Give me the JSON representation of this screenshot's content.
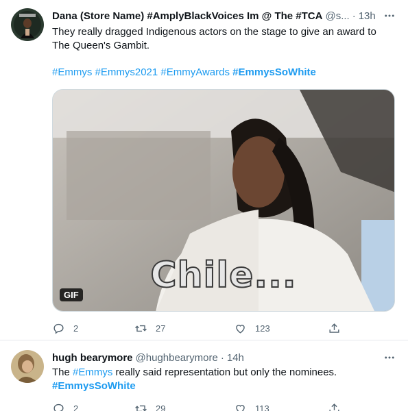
{
  "tweets": [
    {
      "display_name": "Dana (Store Name) #AmplyBlackVoices Im @ The #TCA",
      "handle": "@s...",
      "separator": "·",
      "time": "13h",
      "text_line": "They really dragged Indigenous actors on the stage to give an award to The Queen's Gambit.",
      "hashtags": [
        "#Emmys",
        "#Emmys2021",
        "#EmmyAwards",
        "#EmmysSoWhite"
      ],
      "media": {
        "caption": "Chile...",
        "badge": "GIF"
      },
      "replies": "2",
      "retweets": "27",
      "likes": "123",
      "avatar_icon": "avatar-icon",
      "more_icon": "more-dots-icon"
    },
    {
      "display_name": "hugh bearymore",
      "handle": "@hughbearymore",
      "separator": "·",
      "time": "14h",
      "text_before": "The ",
      "text_hashtag": "#Emmys",
      "text_after": " really said representation but only the nominees.",
      "hashtag_line": "#EmmysSoWhite",
      "replies": "2",
      "retweets": "29",
      "likes": "113"
    }
  ],
  "icons": [
    "reply-icon",
    "retweet-icon",
    "like-icon",
    "share-icon"
  ],
  "colors": {
    "link": "#1d9bf0",
    "muted": "#536471",
    "text": "#0f1419"
  }
}
